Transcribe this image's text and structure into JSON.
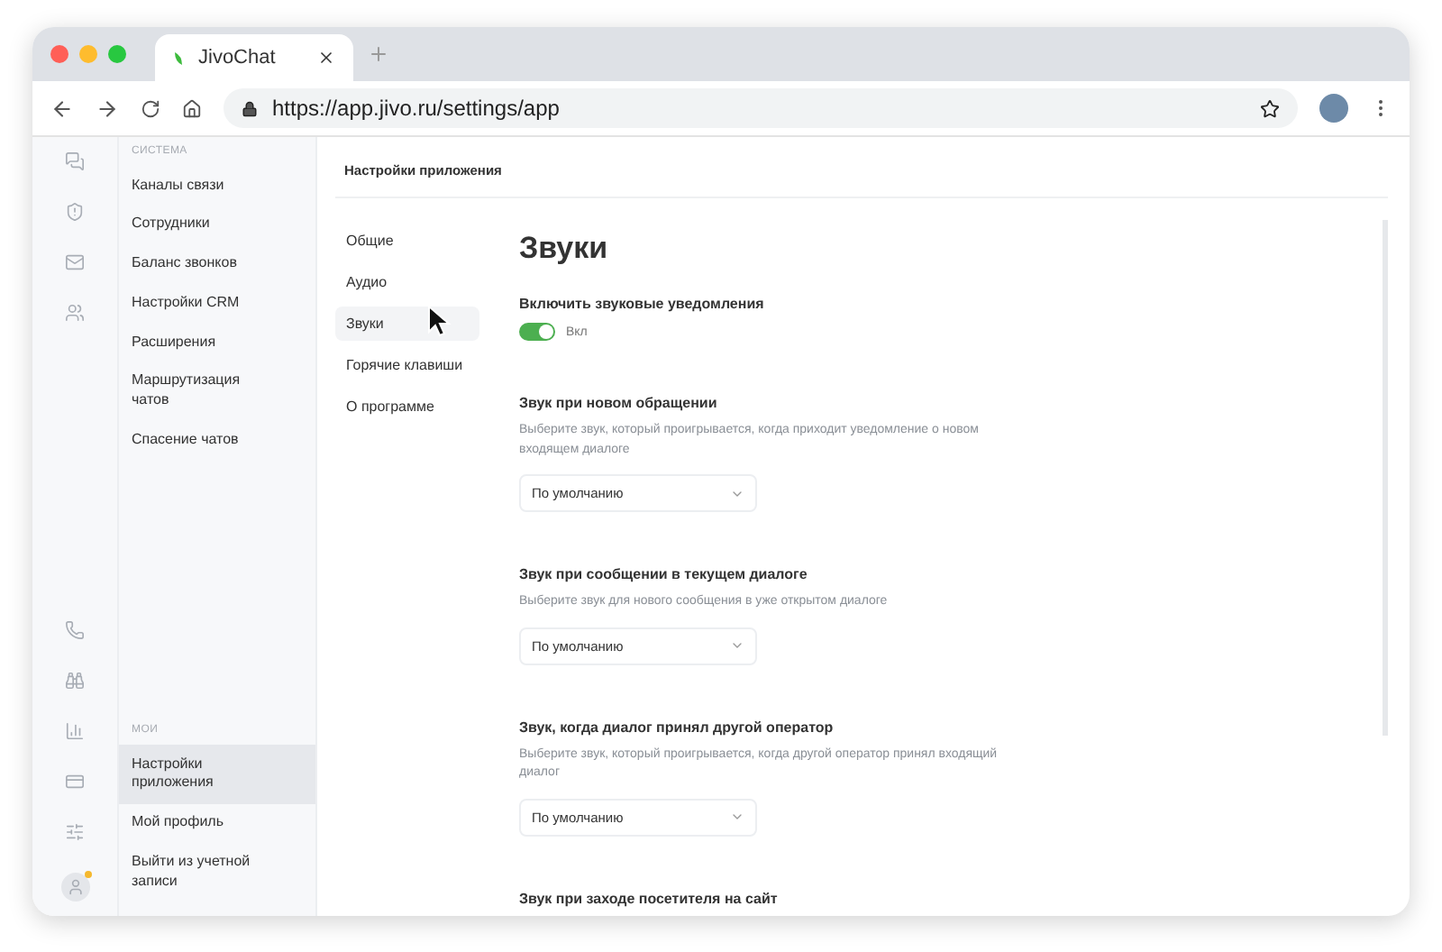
{
  "browser": {
    "tab": {
      "title": "JivoChat"
    },
    "url": "https://app.jivo.ru/settings/app"
  },
  "sidebar": {
    "groups": [
      {
        "heading": "СИСТЕМА",
        "items": [
          {
            "label": "Каналы связи",
            "selected": false
          },
          {
            "label": "Сотрудники",
            "selected": false
          },
          {
            "label": "Баланс звонков",
            "selected": false
          },
          {
            "label": "Настройки CRM",
            "selected": false
          },
          {
            "label": "Расширения",
            "selected": false
          },
          {
            "label": "Маршрутизация чатов",
            "selected": false
          },
          {
            "label": "Спасение чатов",
            "selected": false
          }
        ]
      },
      {
        "heading": "МОИ",
        "items": [
          {
            "label": "Настройки приложения",
            "selected": true
          },
          {
            "label": "Мой профиль",
            "selected": false
          },
          {
            "label": "Выйти из учетной записи",
            "selected": false
          }
        ]
      }
    ]
  },
  "page_title": "Настройки приложения",
  "settings_nav": [
    {
      "label": "Общие",
      "selected": false
    },
    {
      "label": "Аудио",
      "selected": false
    },
    {
      "label": "Звуки",
      "selected": true
    },
    {
      "label": "Горячие клавиши",
      "selected": false
    },
    {
      "label": "О программе",
      "selected": false
    }
  ],
  "heading": "Звуки",
  "sections": [
    {
      "kind": "toggle",
      "title": "Включить звуковые уведомления",
      "on": true,
      "toggle_label": "Вкл"
    },
    {
      "kind": "select",
      "title": "Звук при новом обращении",
      "description": "Выберите звук, который проигрывается, когда приходит уведомление о новом входящем диалоге",
      "value": "По умолчанию"
    },
    {
      "kind": "select",
      "title": "Звук при сообщении в текущем диалоге",
      "description": "Выберите звук для нового сообщения в уже открытом диалоге",
      "value": "По умолчанию"
    },
    {
      "kind": "select",
      "title": "Звук, когда диалог принял другой оператор",
      "description": "Выберите звук, который проигрывается, когда другой оператор принял входящий диалог",
      "value": "По умолчанию"
    },
    {
      "kind": "select",
      "title": "Звук при заходе посетителя на сайт"
    }
  ]
}
